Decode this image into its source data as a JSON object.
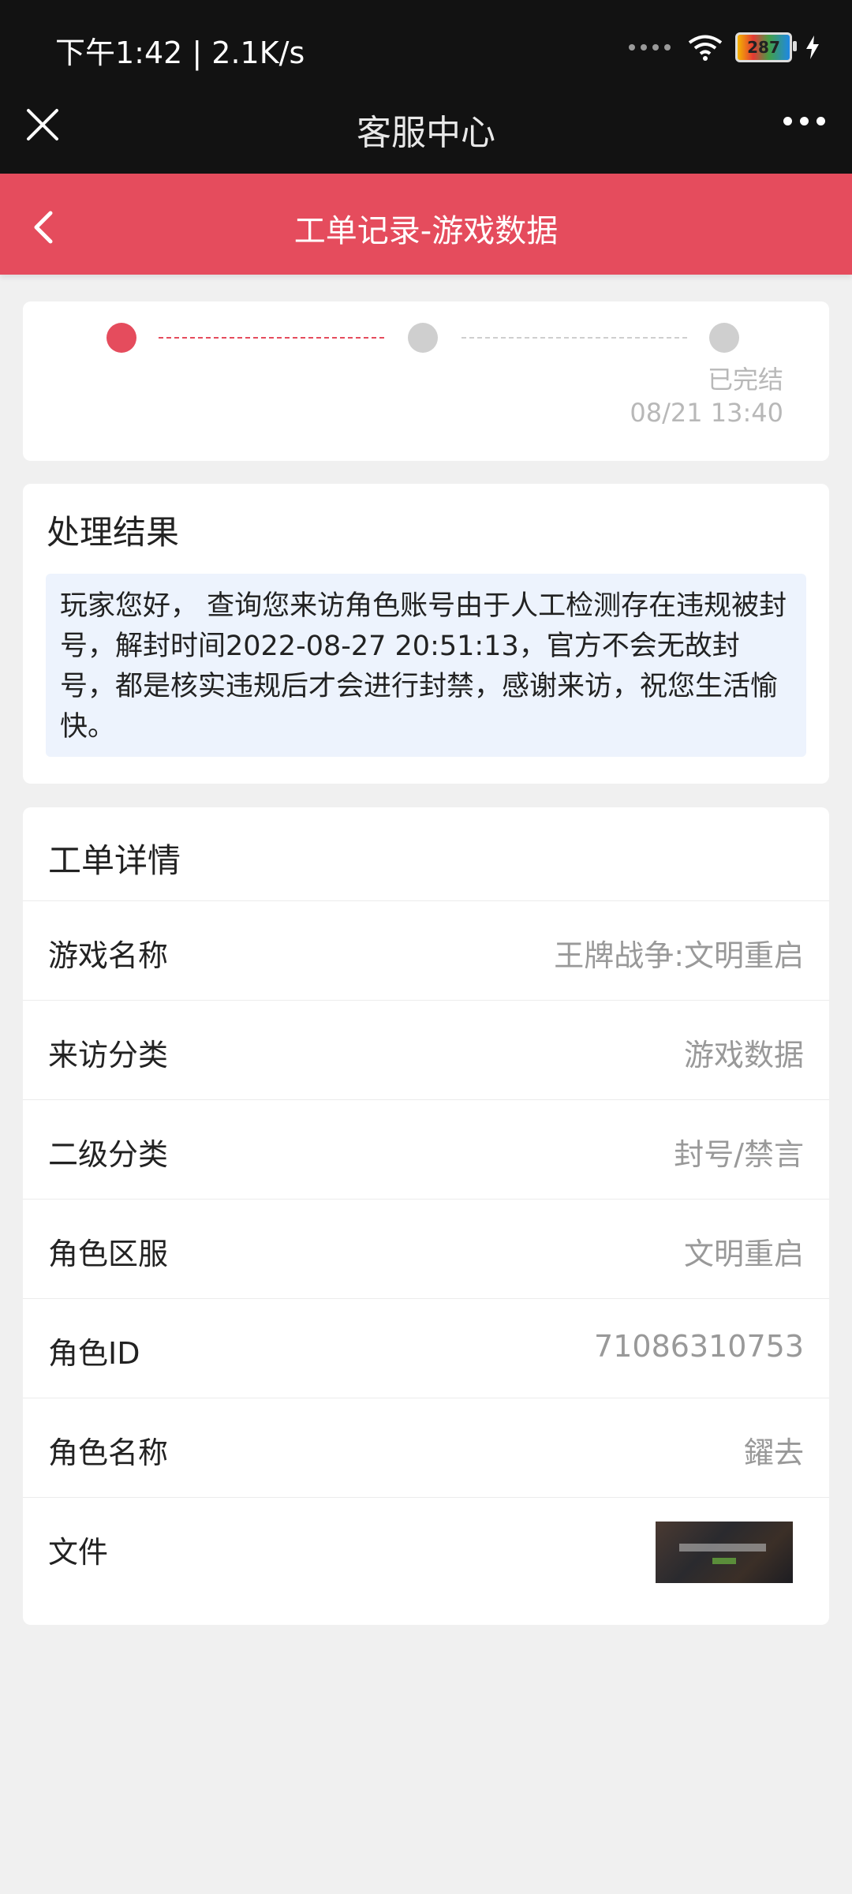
{
  "status_bar": {
    "time_speed": "下午1:42 | 2.1K/s",
    "battery_label": "287"
  },
  "app_bar": {
    "title": "客服中心"
  },
  "page_bar": {
    "title": "工单记录-游戏数据"
  },
  "progress": {
    "steps": [
      {
        "state": "active",
        "color": "#e54c5d"
      },
      {
        "state": "inactive",
        "color": "#cfcfcf"
      },
      {
        "state": "inactive",
        "color": "#cfcfcf"
      }
    ],
    "status_label": "已完结",
    "status_time": "08/21 13:40"
  },
  "result": {
    "title": "处理结果",
    "text": "玩家您好， 查询您来访角色账号由于人工检测存在违规被封号，解封时间2022-08-27 20:51:13，官方不会无故封号，都是核实违规后才会进行封禁，感谢来访，祝您生活愉快。"
  },
  "details": {
    "title": "工单详情",
    "rows": [
      {
        "label": "游戏名称",
        "value": "王牌战争:文明重启"
      },
      {
        "label": "来访分类",
        "value": "游戏数据"
      },
      {
        "label": "二级分类",
        "value": "封号/禁言"
      },
      {
        "label": "角色区服",
        "value": "文明重启"
      },
      {
        "label": "角色ID",
        "value": "71086310753"
      },
      {
        "label": "角色名称",
        "value": "鑃去"
      },
      {
        "label": "文件",
        "value": ""
      }
    ]
  },
  "colors": {
    "accent": "#e54c5d",
    "dark_bar": "#121212",
    "result_bg": "#edf3fd"
  }
}
